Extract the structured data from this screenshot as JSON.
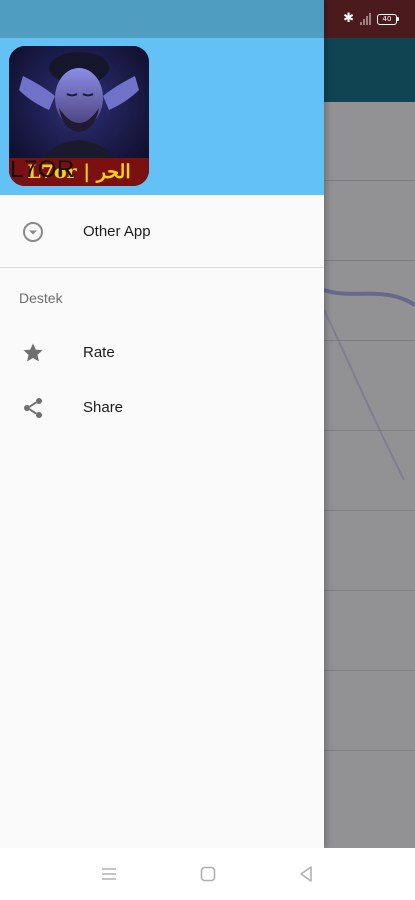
{
  "drawer": {
    "avatar_text": "L7or | الحر",
    "app_name": "L7OR",
    "items": [
      {
        "label": "Other App",
        "icon": "chevron-down-circle-icon"
      },
      {
        "label": "Rate",
        "icon": "star-icon"
      },
      {
        "label": "Share",
        "icon": "share-icon"
      }
    ],
    "section_title": "Destek"
  },
  "status_bar": {
    "battery": "40"
  },
  "navigation_bar": {
    "buttons": [
      "menu-icon",
      "home-icon",
      "back-icon"
    ]
  },
  "colors": {
    "header": "#64c1f5",
    "drawer_status": "#4f9ec2",
    "bg_status": "#7a2a2f",
    "bg_toolbar": "#1b6e86"
  }
}
